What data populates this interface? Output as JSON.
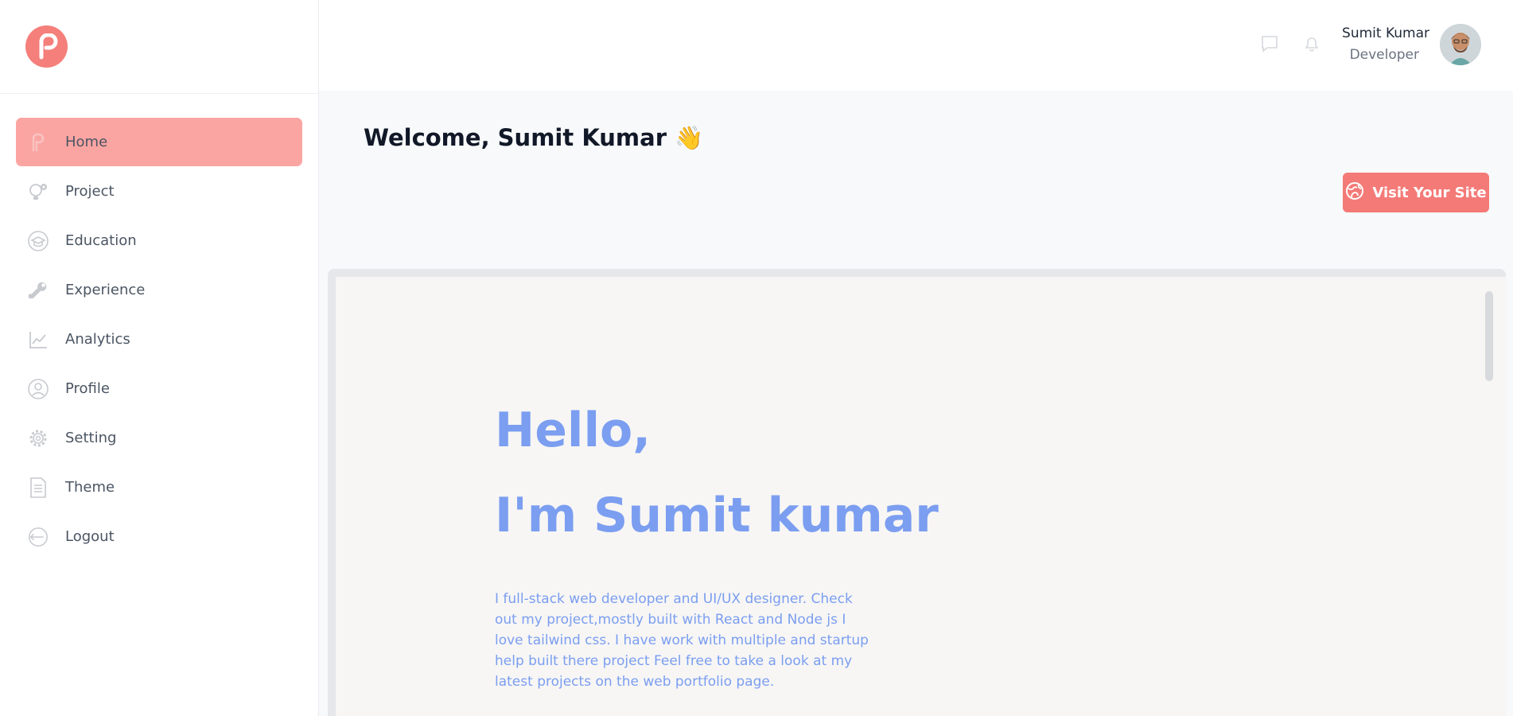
{
  "sidebar": {
    "items": [
      {
        "label": "Home",
        "icon": "home-icon",
        "active": true
      },
      {
        "label": "Project",
        "icon": "bulb-gear-icon",
        "active": false
      },
      {
        "label": "Education",
        "icon": "graduation-cap-icon",
        "active": false
      },
      {
        "label": "Experience",
        "icon": "tools-icon",
        "active": false
      },
      {
        "label": "Analytics",
        "icon": "line-chart-icon",
        "active": false
      },
      {
        "label": "Profile",
        "icon": "user-circle-icon",
        "active": false
      },
      {
        "label": "Setting",
        "icon": "gear-icon",
        "active": false
      },
      {
        "label": "Theme",
        "icon": "document-list-icon",
        "active": false
      },
      {
        "label": "Logout",
        "icon": "logout-icon",
        "active": false
      }
    ]
  },
  "header": {
    "user_name": "Sumit Kumar",
    "user_role": "Developer"
  },
  "main": {
    "welcome": "Welcome, Sumit Kumar 👋",
    "visit_button": "Visit Your Site",
    "preview": {
      "greeting": "Hello,",
      "intro": "I'm Sumit kumar",
      "bio": "I full-stack web developer and UI/UX designer. Check out my project,mostly built with React and Node js I love tailwind css. I have work with multiple and startup help built there project Feel free to take a look at my latest projects on the web portfolio page."
    }
  },
  "colors": {
    "accent": "#f47a77",
    "active_nav": "#fba5a3",
    "preview_text": "#7b9ef0"
  }
}
